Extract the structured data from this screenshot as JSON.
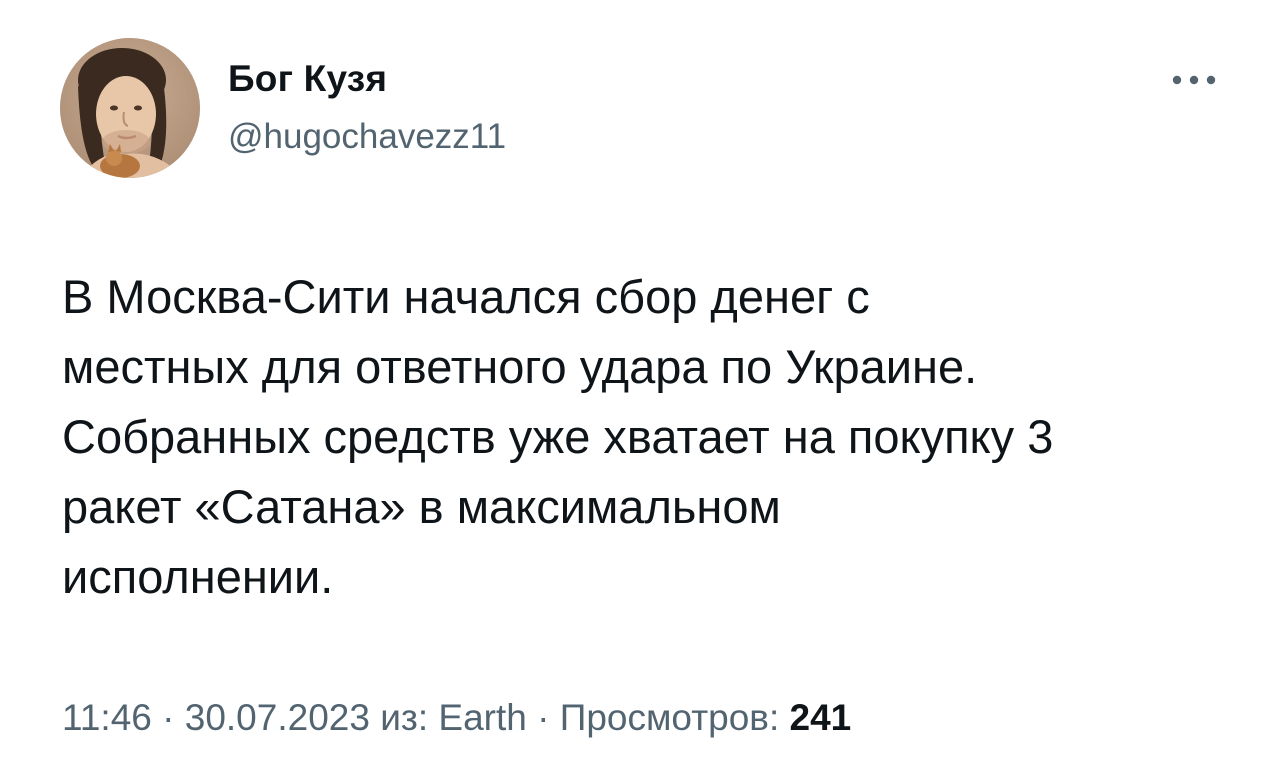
{
  "author": {
    "display_name": "Бог Кузя",
    "handle": "@hugochavezz11",
    "avatar_icon": "user-avatar"
  },
  "more_icon": "more-horizontal-icon",
  "tweet": {
    "text": "В Москва-Сити начался сбор денег с\nместных для ответного удара по Украине.\nСобранных средств уже хватает на покупку 3\nракет «Сатана» в максимальном\nисполнении."
  },
  "meta": {
    "time": "11:46",
    "separator_1": " · ",
    "date": "30.07.2023",
    "source_prefix": " из: ",
    "source": "Earth",
    "separator_2": " · ",
    "views_label": "Просмотров: ",
    "views_count": "241"
  },
  "colors": {
    "text_primary": "#0f1419",
    "text_secondary": "#536471",
    "background": "#ffffff"
  }
}
